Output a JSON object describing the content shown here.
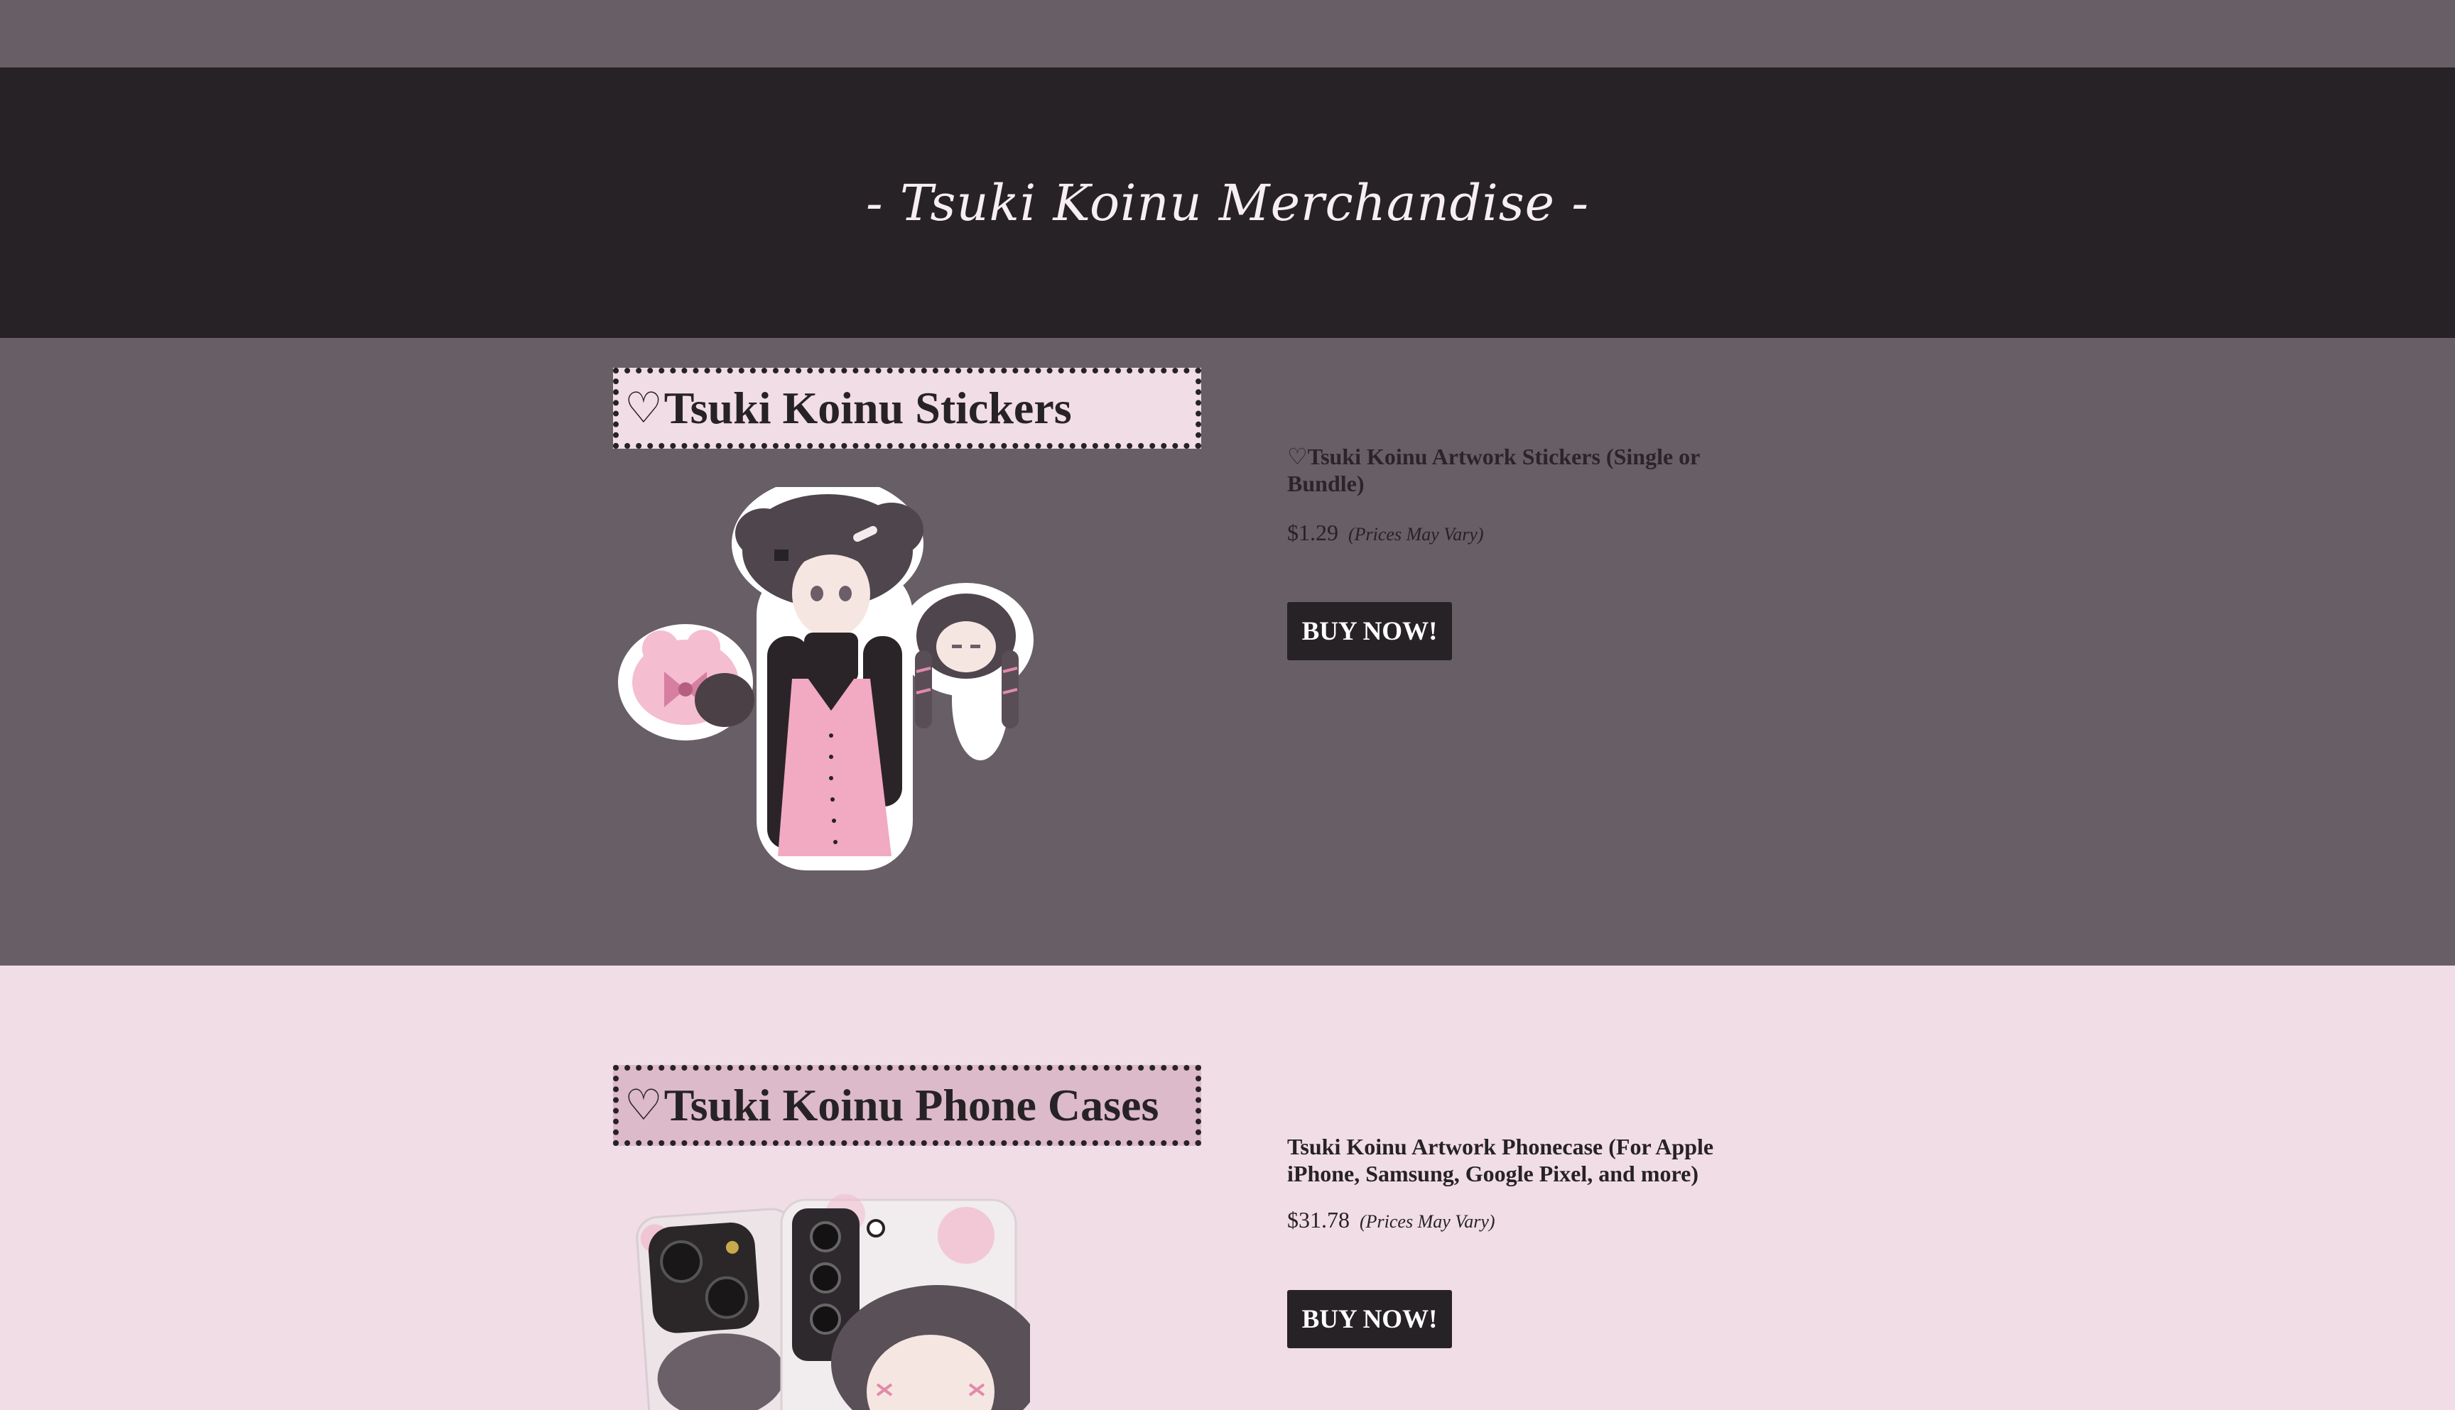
{
  "header": {
    "title": "- Tsuki Koinu Merchandise -"
  },
  "stickers": {
    "heading_heart": "♡",
    "heading": "Tsuki Koinu Stickers",
    "product_title": "♡Tsuki Koinu Artwork Stickers (Single or Bundle)",
    "price": "$1.29",
    "price_note": "(Prices May Vary)",
    "buy_label": "BUY NOW!"
  },
  "phone_cases": {
    "heading_heart": "♡",
    "heading": "Tsuki Koinu Phone Cases",
    "product_title": "Tsuki Koinu Artwork Phonecase (For Apple iPhone, Samsung, Google Pixel, and more)",
    "price": "$31.78",
    "price_note": "(Prices May Vary)",
    "buy_label": "BUY NOW!"
  },
  "colors": {
    "dark": "#272226",
    "mauve": "#675e66",
    "light_pink": "#f0dde6",
    "tag_pink": "#dcbac9",
    "dress_pink": "#f2a9c2"
  }
}
